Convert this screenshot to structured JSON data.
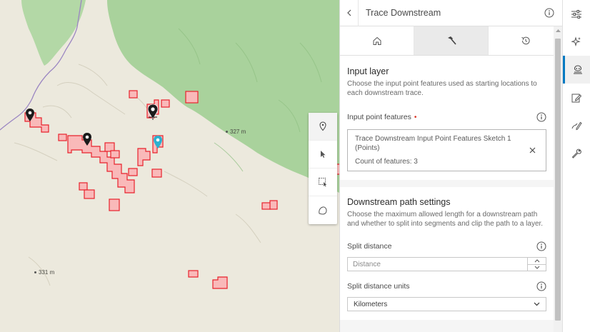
{
  "panel": {
    "title": "Trace Downstream",
    "tabs": [
      {
        "icon": "home-icon",
        "active": false
      },
      {
        "icon": "hammer-icon",
        "active": true
      },
      {
        "icon": "history-icon",
        "active": false
      }
    ],
    "input_layer": {
      "title": "Input layer",
      "description": "Choose the input point features used as starting locations to each downstream trace.",
      "field_label": "Input point features",
      "required_mark": "•",
      "selected_title": "Trace Downstream Input Point Features Sketch 1 (Points)",
      "selected_count": "Count of features: 3"
    },
    "path_settings": {
      "title": "Downstream path settings",
      "description": "Choose the maximum allowed length for a downstream path and whether to split into segments and clip the path to a layer.",
      "split_distance_label": "Split distance",
      "split_distance_placeholder": "Distance",
      "split_units_label": "Split distance units",
      "split_units_value": "Kilometers"
    }
  },
  "map": {
    "elevation_labels": [
      "327 m",
      "331 m"
    ],
    "colors": {
      "forest": "#a8d19a",
      "land": "#ece9dd",
      "polygon_fill": "#f9b9b9",
      "polygon_stroke": "#e8222c",
      "pin_dark": "#1b1b1b",
      "pin_selected": "#2ab1d0",
      "road": "#9b86c2"
    }
  },
  "sketch_tools": [
    "point-tool-icon",
    "select-arrow-icon",
    "rect-select-icon",
    "lasso-select-icon"
  ],
  "rail": [
    "settings-sliders-icon",
    "sparkle-icon",
    "analysis-icon",
    "edit-icon",
    "sketch-icon",
    "wrench-icon"
  ]
}
